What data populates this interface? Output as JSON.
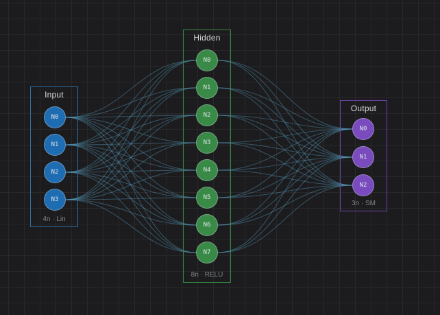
{
  "canvas": {
    "background": "#1c1c1e",
    "grid_color": "#28282b"
  },
  "connections": {
    "color": "#5ba3c6",
    "opacity": 0.4
  },
  "layers": [
    {
      "id": "input",
      "title": "Input",
      "footer": "4n · Lin",
      "border_color": "#2e6da4",
      "node_color": "#1e6cb2",
      "nodes": [
        "N0",
        "N1",
        "N2",
        "N3"
      ]
    },
    {
      "id": "hidden",
      "title": "Hidden",
      "footer": "8n · RELU",
      "border_color": "#378a42",
      "node_color": "#398a46",
      "nodes": [
        "N0",
        "N1",
        "N2",
        "N3",
        "N4",
        "N5",
        "N6",
        "N7"
      ]
    },
    {
      "id": "output",
      "title": "Output",
      "footer": "3n · SM",
      "border_color": "#6d42a8",
      "node_color": "#7a4bbe",
      "nodes": [
        "N0",
        "N1",
        "N2"
      ]
    }
  ]
}
